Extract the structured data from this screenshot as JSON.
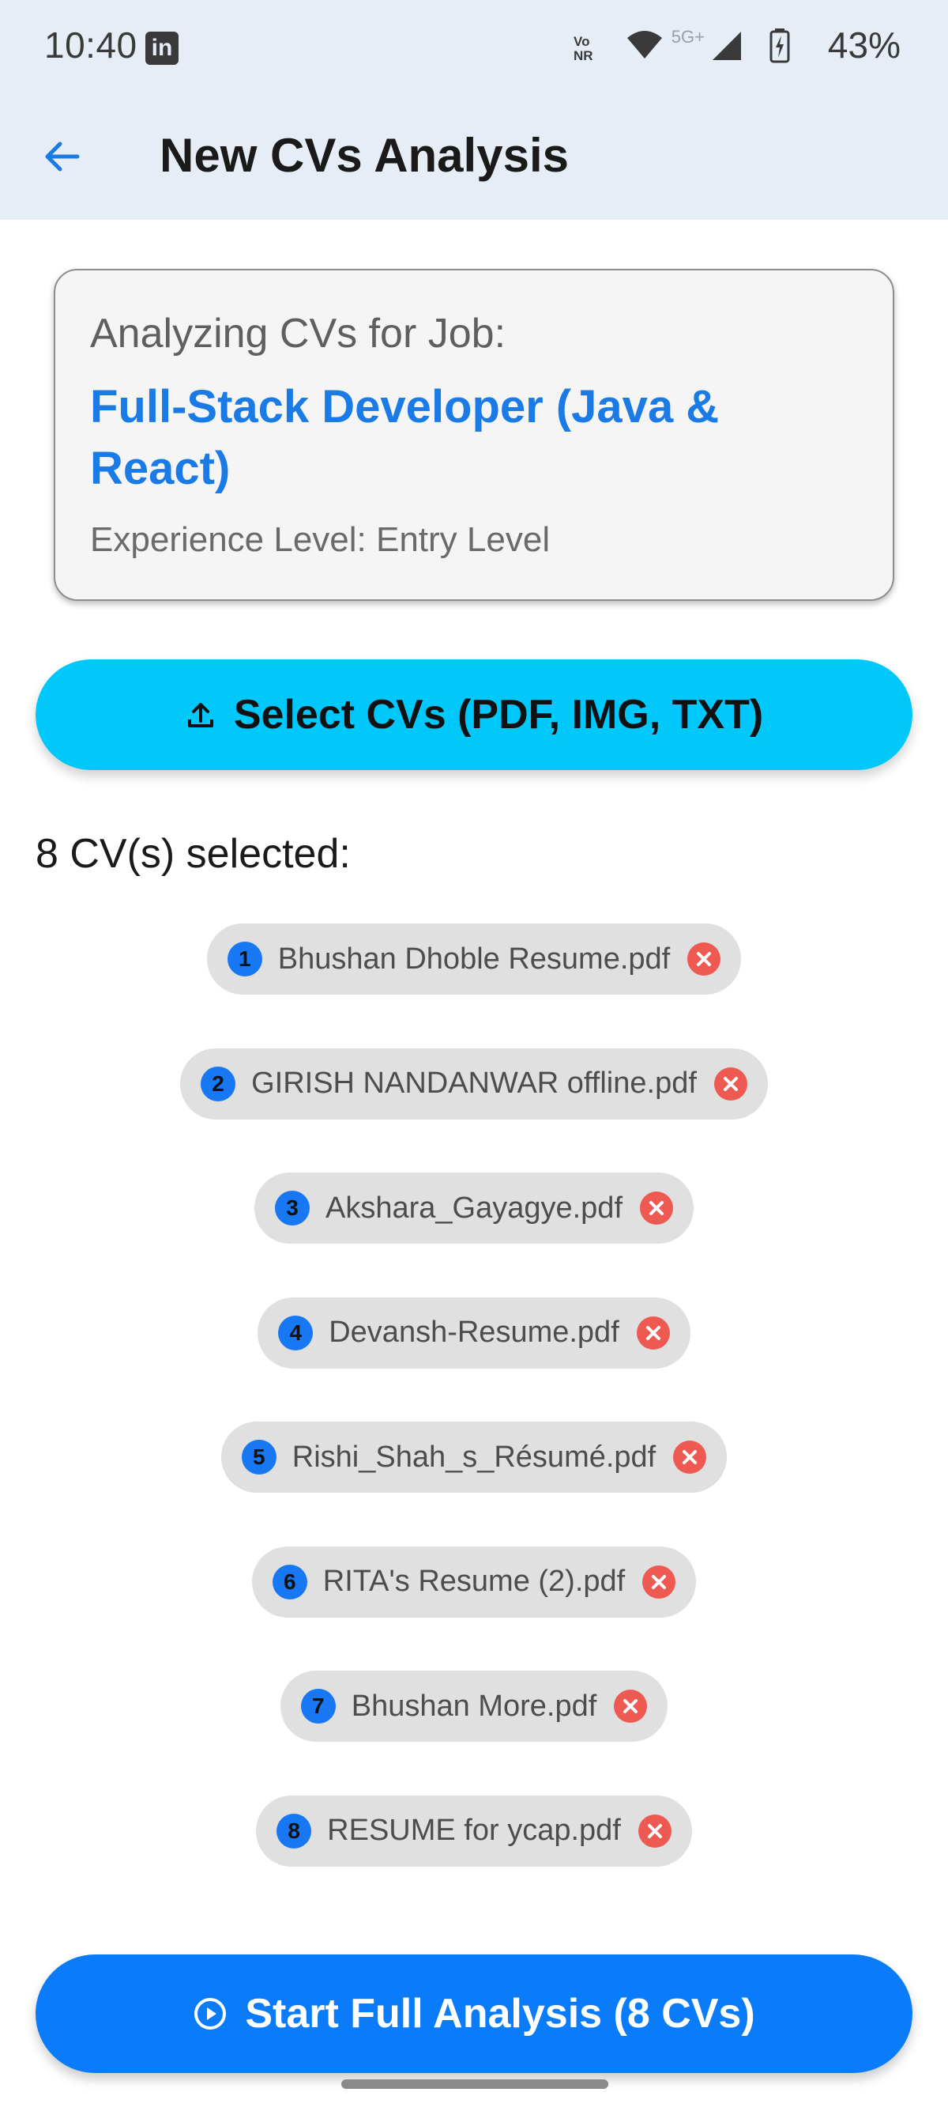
{
  "status_bar": {
    "time": "10:40",
    "app_icon": "linkedin-icon",
    "volte": "Vo⁹\nNR",
    "network": "5G+",
    "battery": "43%"
  },
  "appbar": {
    "back_icon": "arrow-left-icon",
    "title": "New CVs Analysis"
  },
  "job_card": {
    "heading": "Analyzing CVs for Job:",
    "job_title": "Full-Stack Developer (Java & React)",
    "experience": "Experience Level: Entry Level"
  },
  "select_button": {
    "icon": "upload-icon",
    "label": "Select CVs (PDF, IMG, TXT)"
  },
  "selected_count": "8 CV(s) selected:",
  "files": [
    {
      "index": "1",
      "name": "Bhushan Dhoble Resume.pdf"
    },
    {
      "index": "2",
      "name": "GIRISH NANDANWAR offline.pdf"
    },
    {
      "index": "3",
      "name": "Akshara_Gayagye.pdf"
    },
    {
      "index": "4",
      "name": "Devansh-Resume.pdf"
    },
    {
      "index": "5",
      "name": "Rishi_Shah_s_Résumé.pdf"
    },
    {
      "index": "6",
      "name": "RITA's Resume (2).pdf"
    },
    {
      "index": "7",
      "name": "Bhushan More.pdf"
    },
    {
      "index": "8",
      "name": "RESUME for ycap.pdf"
    }
  ],
  "start_button": {
    "icon": "play-circle-icon",
    "label": "Start Full Analysis (8 CVs)"
  },
  "colors": {
    "appbar_bg": "#e6edf7",
    "accent_blue": "#1a7be6",
    "select_btn": "#00c8fa",
    "start_btn": "#0a7cfa",
    "remove_red": "#ee5a52"
  }
}
